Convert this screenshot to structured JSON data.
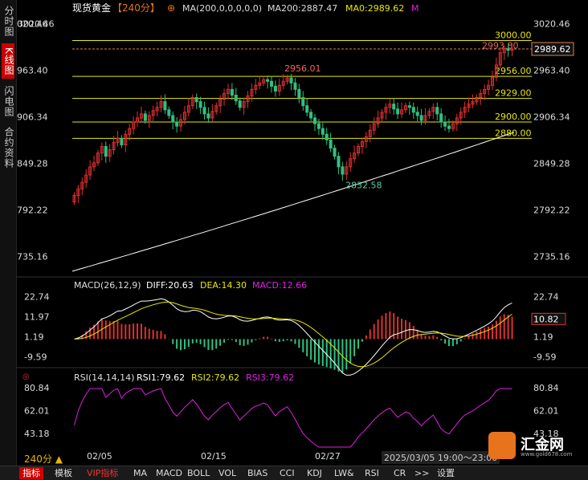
{
  "left_tabs": [
    "分时图",
    "K线图",
    "闪电图",
    "合约资料"
  ],
  "active_tab": 1,
  "header": {
    "name": "现货黄金",
    "period": "【240分】",
    "ma": "MA(200,0,0,0,0,0)",
    "ma200": "MA200:2887.47",
    "ma0": "MA0:2989.62",
    "mark": "M"
  },
  "price_axis": [
    "3020.46",
    "2963.40",
    "2906.34",
    "2849.28",
    "2792.22",
    "2735.16"
  ],
  "levels": [
    {
      "label": "3000.00",
      "value": 3000
    },
    {
      "label": "2956.00",
      "value": 2956
    },
    {
      "label": "2929.00",
      "value": 2929
    },
    {
      "label": "2900.00",
      "value": 2900
    },
    {
      "label": "2880.00",
      "value": 2880
    }
  ],
  "current_price": "2989.62",
  "hi_label": "2993.80",
  "annotations": {
    "high": "2956.01",
    "low": "2832.58"
  },
  "macd": {
    "title": "MACD(26,12,9)",
    "diff": "DIFF:20.63",
    "dea": "DEA:14.30",
    "macd": "MACD:12.66",
    "axis": [
      "22.74",
      "11.97",
      "1.19",
      "-9.59"
    ],
    "current": "10.82"
  },
  "rsi": {
    "title": "RSI(14,14,14)",
    "rsi1": "RSI1:79.62",
    "rsi2": "RSI2:79.62",
    "rsi3": "RSI3:79.62",
    "axis": [
      "80.84",
      "62.01",
      "43.18"
    ]
  },
  "dates": [
    "02/05",
    "02/15",
    "02/27"
  ],
  "period_label": "240分 ▲",
  "time_range": "2025/03/05 19:00～23:00",
  "logo": {
    "name": "汇金网",
    "url": "www.gold678.com"
  },
  "bottom_buttons": [
    "指标",
    "模板",
    "VIP指标",
    "MA",
    "MACD",
    "BOLL",
    "VOL",
    "BIAS",
    "CCI",
    "KDJ",
    "LW&",
    "RSI",
    "CR",
    ">>",
    "设置"
  ],
  "colors": {
    "up": "#e03030",
    "down": "#30c080",
    "ma": "#ffffff",
    "level": "#e8e800",
    "macd": "#e020e0",
    "dea": "#e8e800",
    "diff": "#ffffff"
  },
  "chart_data": {
    "type": "candlestick",
    "title": "现货黄金",
    "ylim": [
      2710,
      3030
    ],
    "candles_close": [
      2810,
      2818,
      2826,
      2835,
      2845,
      2850,
      2862,
      2870,
      2858,
      2866,
      2875,
      2880,
      2872,
      2885,
      2892,
      2900,
      2905,
      2910,
      2902,
      2908,
      2914,
      2918,
      2925,
      2915,
      2908,
      2900,
      2895,
      2903,
      2912,
      2920,
      2930,
      2925,
      2918,
      2910,
      2905,
      2913,
      2920,
      2928,
      2935,
      2940,
      2933,
      2926,
      2918,
      2925,
      2932,
      2940,
      2945,
      2948,
      2952,
      2950,
      2944,
      2938,
      2945,
      2950,
      2954,
      2948,
      2940,
      2930,
      2920,
      2912,
      2905,
      2898,
      2892,
      2885,
      2878,
      2868,
      2858,
      2845,
      2836,
      2845,
      2855,
      2862,
      2870,
      2876,
      2882,
      2890,
      2898,
      2905,
      2912,
      2918,
      2922,
      2916,
      2910,
      2915,
      2920,
      2918,
      2912,
      2908,
      2902,
      2908,
      2913,
      2918,
      2910,
      2900,
      2895,
      2892,
      2898,
      2905,
      2912,
      2918,
      2922,
      2925,
      2930,
      2935,
      2940,
      2945,
      2955,
      2970,
      2985,
      2990,
      2988,
      2989.62
    ],
    "ma200": {
      "start": 2717,
      "end": 2887.47
    },
    "macd_diff_range": [
      -14,
      22.74
    ],
    "rsi_range": [
      30,
      80.84
    ]
  }
}
